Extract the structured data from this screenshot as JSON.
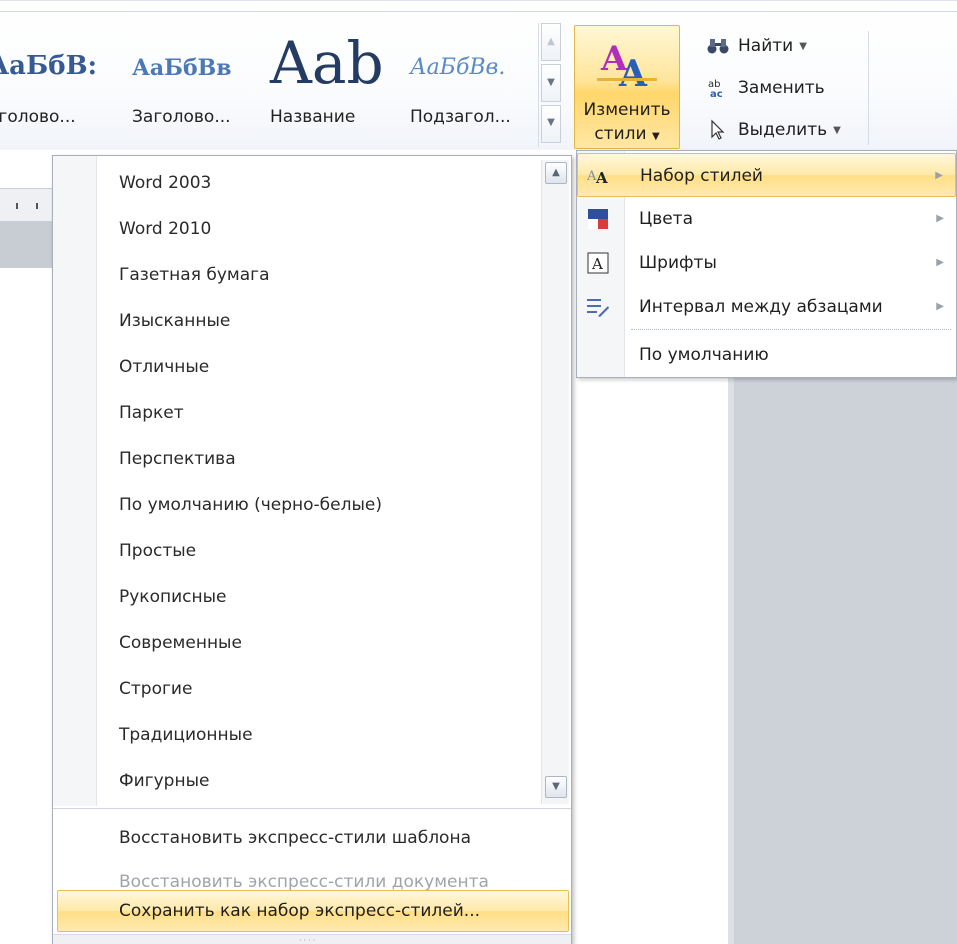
{
  "ribbon": {
    "styles_gallery": [
      {
        "sample": "АаБбВ:",
        "name": "аголово..."
      },
      {
        "sample": "АаБбВв",
        "name": "Заголово..."
      },
      {
        "sample": "Aab",
        "name": "Название"
      },
      {
        "sample": "АаБбВв.",
        "name": "Подзагол..."
      }
    ],
    "change_styles": {
      "line1": "Изменить",
      "line2": "стили"
    },
    "editing": {
      "find": "Найти",
      "replace": "Заменить",
      "select": "Выделить"
    }
  },
  "styleset_menu": {
    "items": [
      "Word 2003",
      "Word 2010",
      "Газетная бумага",
      "Изысканные",
      "Отличные",
      "Паркет",
      "Перспектива",
      "По умолчанию (черно-белые)",
      "Простые",
      "Рукописные",
      "Современные",
      "Строгие",
      "Традиционные",
      "Фигурные"
    ],
    "restore_template": "Восстановить экспресс-стили шаблона",
    "restore_document": "Восстановить экспресс-стили документа",
    "save_as": "Сохранить как набор экспресс-стилей..."
  },
  "submenu": {
    "style_set": "Набор стилей",
    "colors": "Цвета",
    "fonts": "Шрифты",
    "paragraph_spacing": "Интервал между абзацами",
    "default": "По умолчанию"
  },
  "colors": {
    "highlight": "#ffe59a",
    "highlight_border": "#e8be55",
    "heading_blue": "#375a93",
    "disabled_text": "#a0a4aa"
  }
}
